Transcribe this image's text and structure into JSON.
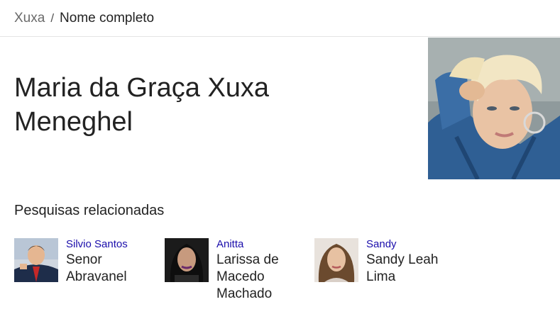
{
  "breadcrumb": {
    "link": "Xuxa",
    "separator": "/",
    "current": "Nome completo"
  },
  "answer": {
    "line1": "Maria da Graça Xuxa",
    "line2": "Meneghel"
  },
  "related": {
    "title": "Pesquisas relacionadas",
    "items": [
      {
        "alias": "Silvio Santos",
        "name_lines": [
          "Senor",
          "Abravanel",
          ""
        ]
      },
      {
        "alias": "Anitta",
        "name_lines": [
          "Larissa de",
          "Macedo",
          "Machado"
        ]
      },
      {
        "alias": "Sandy",
        "name_lines": [
          "Sandy Leah",
          "Lima",
          ""
        ]
      }
    ]
  },
  "colors": {
    "link_blue": "#1a0dab",
    "text": "#222222",
    "breadcrumb_gray": "#6a6a6a"
  }
}
